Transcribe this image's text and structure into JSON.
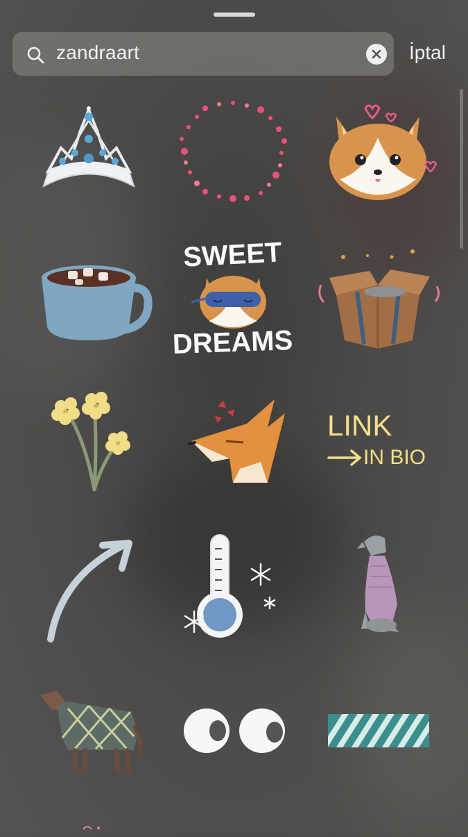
{
  "search": {
    "value": "zandraart",
    "cancel_label": "İptal"
  },
  "stickers": [
    {
      "icon": "tiara-icon"
    },
    {
      "icon": "heart-wreath-icon"
    },
    {
      "icon": "corgi-hearts-icon"
    },
    {
      "icon": "hot-cocoa-mug-icon"
    },
    {
      "icon": "sweet-dreams-corgi-icon",
      "text_line1": "SWEET",
      "text_line2": "DREAMS"
    },
    {
      "icon": "open-box-icon"
    },
    {
      "icon": "yellow-flowers-icon"
    },
    {
      "icon": "angry-fox-icon"
    },
    {
      "icon": "link-in-bio-icon",
      "text_line1": "LINK",
      "text_line2": "IN BIO"
    },
    {
      "icon": "curved-arrow-icon"
    },
    {
      "icon": "thermometer-snowflake-icon"
    },
    {
      "icon": "dog-sweater-icon"
    },
    {
      "icon": "horse-blanket-icon"
    },
    {
      "icon": "googly-eyes-icon"
    },
    {
      "icon": "striped-tape-icon"
    }
  ],
  "colors": {
    "text": "#f2f2f2",
    "search_bg": "#8c8a87",
    "tape_teal": "#3a8f8d",
    "link_yellow": "#f3e08a"
  }
}
